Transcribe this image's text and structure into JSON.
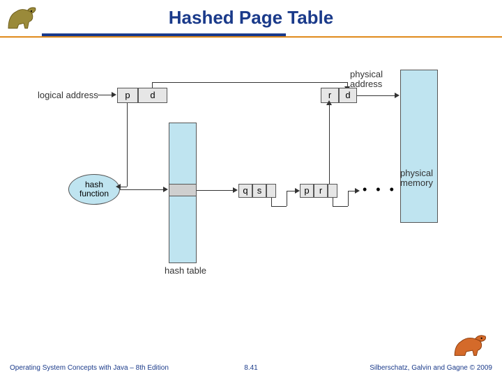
{
  "title": "Hashed Page Table",
  "labels": {
    "logical_address": "logical address",
    "physical_address": "physical\naddress",
    "hash_function": "hash\nfunction",
    "hash_table": "hash table",
    "physical_memory": "physical\nmemory",
    "p": "p",
    "d": "d",
    "q": "q",
    "s": "s",
    "r": "r",
    "dots": "• • •"
  },
  "footer": {
    "left": "Operating System Concepts with Java – 8th Edition",
    "center": "8.41",
    "right": "Silberschatz, Galvin and Gagne © 2009"
  }
}
